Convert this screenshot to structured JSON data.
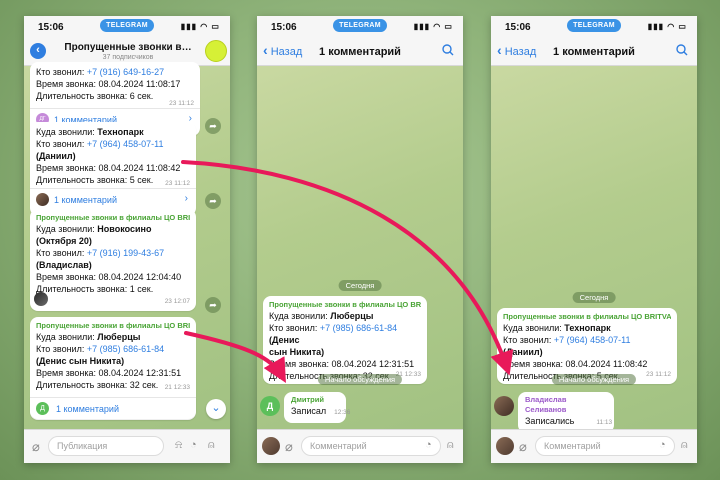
{
  "status": {
    "time": "15:06",
    "app": "TELEGRAM"
  },
  "phone1": {
    "title": "Пропущенные звонки в…",
    "subtitle": "37 подписчиков",
    "back_badge": "1",
    "msg0": {
      "line1_label": "Кто звонил: ",
      "line1_phone": "+7 (916) 649-16-27",
      "line2": "Время звонка: 08.04.2024 11:08:17",
      "line3": "Длительность звонка: 6 сек.",
      "time": "23 11:12",
      "comments": "1 комментарий",
      "av": "ДГ"
    },
    "msg1": {
      "where_label": "Куда звонили: ",
      "where": "Технопарк",
      "who_label": "Кто звонил: ",
      "phone": "+7 (964) 458-07-11",
      "name": "(Даниил)",
      "time_line": "Время звонка: 08.04.2024 11:08:42",
      "dur": "Длительность звонка: 5 сек.",
      "time": "23 11:12",
      "comments": "1 комментарий"
    },
    "msg2": {
      "src": "Пропущенные звонки в филиалы ЦО BRITVA",
      "where_label": "Куда звонили: ",
      "where": "Новокосино (Октября 20)",
      "who_label": "Кто звонил: ",
      "phone": "+7 (916) 199-43-67",
      "name": "(Владислав)",
      "time_line": "Время звонка: 08.04.2024 12:04:40",
      "dur": "Длительность звонка: 1 сек.",
      "time": "23 12:07"
    },
    "msg3": {
      "src": "Пропущенные звонки в филиалы ЦО BRITVA",
      "where_label": "Куда звонили: ",
      "where": "Люберцы",
      "who_label": "Кто звонил: ",
      "phone": "+7 (985) 686-61-84",
      "name": "(Денис сын Никита)",
      "time_line": "Время звонка: 08.04.2024 12:31:51",
      "dur": "Длительность звонка: 32 сек.",
      "time": "21 12:33",
      "comments": "1 комментарий",
      "av": "Д"
    },
    "input_placeholder": "Публикация"
  },
  "phone2": {
    "back": "Назад",
    "title": "1 комментарий",
    "date_pill": "Сегодня",
    "msg": {
      "src": "Пропущенные звонки в филиалы ЦО BRITVA",
      "where_label": "Куда звонили: ",
      "where": "Люберцы",
      "who_label": "Кто звонил: ",
      "phone": "+7 (985) 686-61-84",
      "name_a": "(Денис",
      "name_b": "сын Никита)",
      "time_line": "Время звонка: 08.04.2024 12:31:51",
      "dur": "Длительность звонка: 32 сек.",
      "time": "21 12:33"
    },
    "discussion": "Начало обсуждения",
    "reply": {
      "who": "Дмитрий",
      "text": "Записал",
      "time": "12:36",
      "av": "Д"
    },
    "input_placeholder": "Комментарий"
  },
  "phone3": {
    "back": "Назад",
    "title": "1 комментарий",
    "date_pill": "Сегодня",
    "msg": {
      "src": "Пропущенные звонки в филиалы ЦО BRITVA",
      "where_label": "Куда звонили: ",
      "where": "Технопарк",
      "who_label": "Кто звонил: ",
      "phone": "+7 (964) 458-07-11",
      "name": "(Даниил)",
      "time_line": "Время звонка: 08.04.2024 11:08:42",
      "dur": "Длительность звонка: 5 сек.",
      "time": "23 11:12"
    },
    "discussion": "Начало обсуждения",
    "reply": {
      "who": "Владислав Селиванов",
      "text": "Записались",
      "time": "11:13"
    },
    "input_placeholder": "Комментарий"
  },
  "colors": {
    "arrow": "#e8195a",
    "link": "#2f7ee0",
    "source": "#4aa436"
  },
  "icons": [
    "back-chevron-icon",
    "search-icon",
    "attach-icon",
    "bell-icon",
    "clock-icon",
    "mic-icon",
    "share-icon",
    "chevron-right-icon",
    "chevron-down-icon",
    "arrow-icon"
  ]
}
